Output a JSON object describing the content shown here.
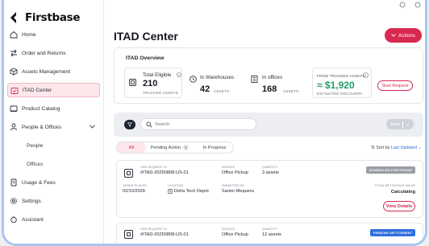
{
  "brand": {
    "name": "Firstbase"
  },
  "sidebar": {
    "items": [
      {
        "label": "Home",
        "icon": "home-icon"
      },
      {
        "label": "Order and Returns",
        "icon": "swap-icon"
      },
      {
        "label": "Assets Management",
        "icon": "box-icon"
      },
      {
        "label": "ITAD Center",
        "icon": "recycle-icon",
        "active": true
      },
      {
        "label": "Product Catalog",
        "icon": "catalog-icon"
      },
      {
        "label": "People & Offices",
        "icon": "person-icon"
      },
      {
        "label": "People",
        "sub": true
      },
      {
        "label": "Offices",
        "sub": true
      },
      {
        "label": "Usage & Fees",
        "icon": "receipt-icon"
      },
      {
        "label": "Settings",
        "icon": "gear-icon"
      },
      {
        "label": "Assistant",
        "icon": "assistant-icon"
      }
    ]
  },
  "header": {
    "title": "ITAD Center",
    "actions_label": "Actions"
  },
  "overview": {
    "title": "ITAD Overview",
    "total_eligible_label": "Total Eligible",
    "total_eligible_value": "210",
    "total_eligible_unit": "TRACKED ASSETS",
    "warehouses_label": "In Warehouses",
    "warehouses_value": "42",
    "warehouses_unit": "ASSETS",
    "offices_label": "In offices",
    "offices_value": "168",
    "offices_unit": "ASSETS",
    "tracked_label": "FROM TRACKED ASSETS",
    "tracked_value": "≈ $1,920",
    "tracked_unit": "ESTIMATED RECOVERY",
    "start_request_label": "Start Request"
  },
  "toolbar": {
    "search_placeholder": "Search",
    "save_label": "Save"
  },
  "tabs": [
    {
      "label": "All",
      "active": true
    },
    {
      "label": "Pending Action",
      "badge": "1"
    },
    {
      "label": "In Progress"
    }
  ],
  "sort": {
    "label": "Sort by",
    "value": "Last Updated"
  },
  "requests": [
    {
      "id_label": "ITAD REQUEST ID",
      "id": "#ITAD-20250808-US-01",
      "source_label": "SOURCE",
      "source": "Office Pickup",
      "quantity_label": "QUANTITY",
      "quantity": "3 assets",
      "status": "SCHEDULED FOR PICKUP",
      "status_color": "#9a9da6",
      "order_placed_label": "ORDER PLACED",
      "order_placed": "02/10/2026",
      "location_label": "LOCATION",
      "location": "Delta Tech Depot",
      "submitted_label": "SUBMITTED BY",
      "submitted": "Sarien Mequera",
      "resale_label": "TOTAL NET RESALE VALUE",
      "resale": "Calculating",
      "view_label": "View Details"
    },
    {
      "id_label": "ITAD REQUEST ID",
      "id": "#ITAD-20250808-US-01",
      "source_label": "SOURCE",
      "source": "Office Pickup",
      "quantity_label": "QUANTITY",
      "quantity": "12 assets",
      "status": "PENDING SETTLEMENT",
      "status_color": "#2f6fe0"
    }
  ],
  "colors": {
    "accent": "#d8294f",
    "green": "#1e9e6a",
    "link": "#2d6fd2"
  }
}
